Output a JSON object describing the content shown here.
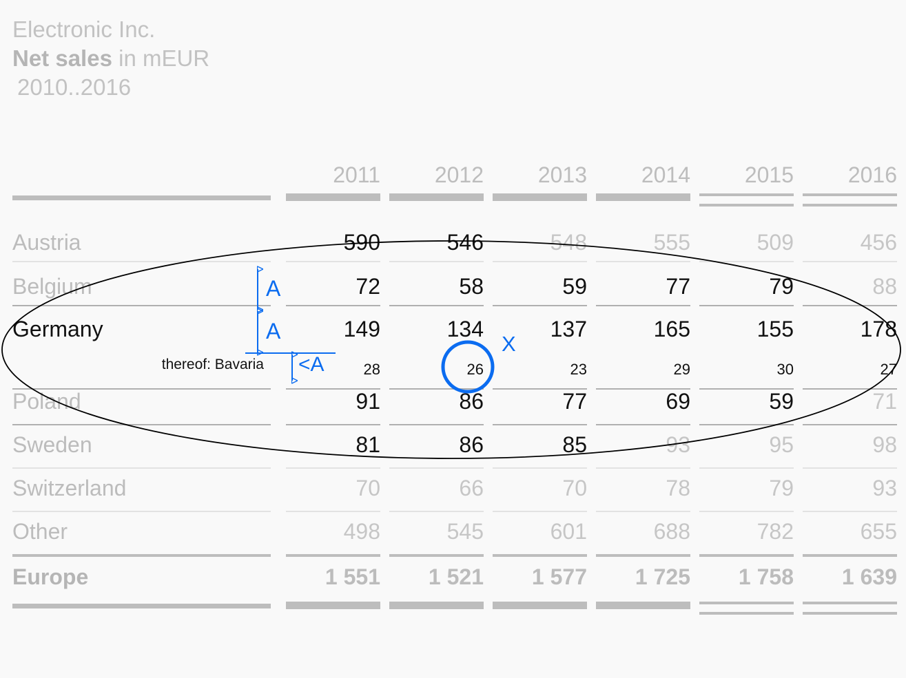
{
  "header": {
    "company": "Electronic Inc.",
    "measure_strong": "Net sales",
    "measure_rest": " in mEUR",
    "period": "2010..2016"
  },
  "table": {
    "row_label_header": "",
    "columns": [
      "2011",
      "2012",
      "2013",
      "2014",
      "2015",
      "2016"
    ],
    "rows": [
      {
        "label": "Austria",
        "values": [
          "590",
          "546",
          "548",
          "555",
          "509",
          "456"
        ]
      },
      {
        "label": "Belgium",
        "values": [
          "72",
          "58",
          "59",
          "77",
          "79",
          "88"
        ]
      },
      {
        "label": "Germany",
        "values": [
          "149",
          "134",
          "137",
          "165",
          "155",
          "178"
        ]
      },
      {
        "label": "thereof: Bavaria",
        "values": [
          "28",
          "26",
          "23",
          "29",
          "30",
          "27"
        ]
      },
      {
        "label": "Poland",
        "values": [
          "91",
          "86",
          "77",
          "69",
          "59",
          "71"
        ]
      },
      {
        "label": "Sweden",
        "values": [
          "81",
          "86",
          "85",
          "93",
          "95",
          "98"
        ]
      },
      {
        "label": "Switzerland",
        "values": [
          "70",
          "66",
          "70",
          "78",
          "79",
          "93"
        ]
      },
      {
        "label": "Other",
        "values": [
          "498",
          "545",
          "601",
          "688",
          "782",
          "655"
        ]
      },
      {
        "label": "Europe",
        "values": [
          "1 551",
          "1 521",
          "1 577",
          "1 725",
          "1 758",
          "1 639"
        ]
      }
    ]
  },
  "annotations": {
    "row_height_label_belgium": "A",
    "row_height_label_germany": "A",
    "row_height_label_bavaria": "<A",
    "cross_marker": "X",
    "highlight_value": "26",
    "accent_color": "#0b6cf0",
    "ellipse_color": "#000000"
  },
  "chart_data": {
    "type": "table",
    "title": "Electronic Inc. Net sales in mEUR 2010..2016",
    "categories": [
      "2011",
      "2012",
      "2013",
      "2014",
      "2015",
      "2016"
    ],
    "series": [
      {
        "name": "Austria",
        "values": [
          590,
          546,
          548,
          555,
          509,
          456
        ]
      },
      {
        "name": "Belgium",
        "values": [
          72,
          58,
          59,
          77,
          79,
          88
        ]
      },
      {
        "name": "Germany",
        "values": [
          149,
          134,
          137,
          165,
          155,
          178
        ]
      },
      {
        "name": "thereof: Bavaria",
        "values": [
          28,
          26,
          23,
          29,
          30,
          27
        ]
      },
      {
        "name": "Poland",
        "values": [
          91,
          86,
          77,
          69,
          59,
          71
        ]
      },
      {
        "name": "Sweden",
        "values": [
          81,
          86,
          85,
          93,
          95,
          98
        ]
      },
      {
        "name": "Switzerland",
        "values": [
          70,
          66,
          70,
          78,
          79,
          93
        ]
      },
      {
        "name": "Other",
        "values": [
          498,
          545,
          601,
          688,
          782,
          655
        ]
      },
      {
        "name": "Europe",
        "values": [
          1551,
          1521,
          1577,
          1725,
          1758,
          1639
        ]
      }
    ],
    "xlabel": "",
    "ylabel": "mEUR",
    "grid": false,
    "legend": "none"
  }
}
